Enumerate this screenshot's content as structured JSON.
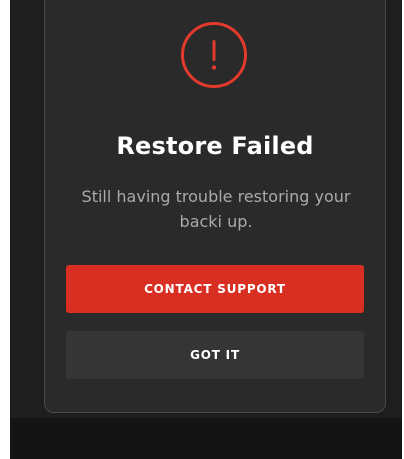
{
  "dialog": {
    "icon": "exclamation-circle-icon",
    "title": "Restore Failed",
    "message": "Still having trouble restoring your backi up.",
    "primary_button_label": "CONTACT SUPPORT",
    "secondary_button_label": "GOT IT"
  },
  "colors": {
    "accent": "#d82f22",
    "icon": "#e33a2e",
    "backdrop": "#1e1e1e",
    "dialog_bg": "#2a2a2a",
    "secondary_button_bg": "#353535",
    "message_text": "#aaaaaa"
  }
}
